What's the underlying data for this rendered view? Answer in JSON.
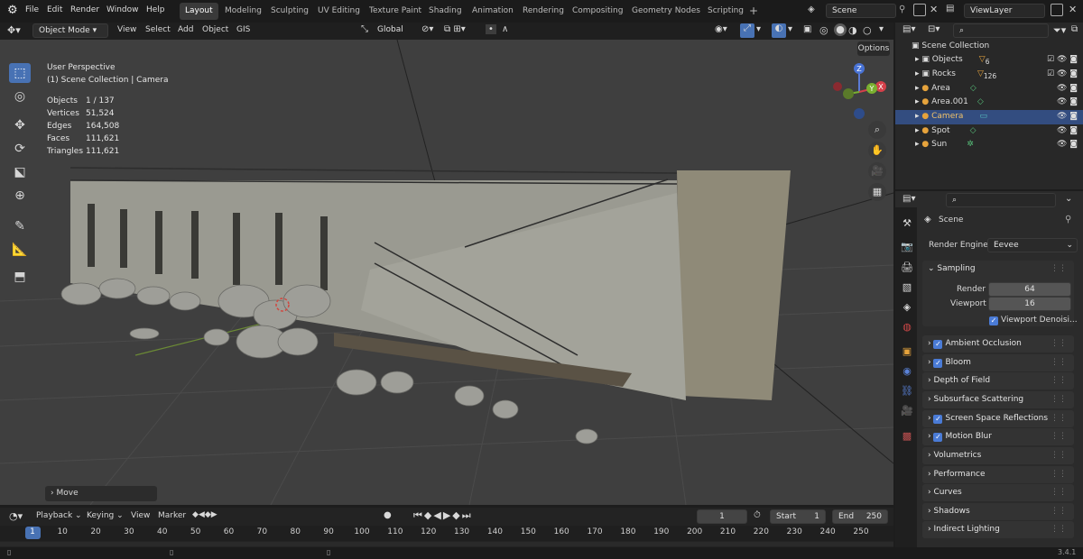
{
  "topbar": {
    "menus": [
      "File",
      "Edit",
      "Render",
      "Window",
      "Help"
    ],
    "workspaces": [
      "Layout",
      "Modeling",
      "Sculpting",
      "UV Editing",
      "Texture Paint",
      "Shading",
      "Animation",
      "Rendering",
      "Compositing",
      "Geometry Nodes",
      "Scripting"
    ],
    "active_workspace": "Layout",
    "add_tab": "+",
    "scene": "Scene",
    "view_layer": "ViewLayer"
  },
  "viewport_header": {
    "mode": "Object Mode",
    "menus": [
      "View",
      "Select",
      "Add",
      "Object",
      "GIS"
    ],
    "orientation": "Global",
    "options": "Options"
  },
  "overlay": {
    "view_name": "User Perspective",
    "collection": "(1) Scene Collection | Camera",
    "stats": [
      {
        "label": "Objects",
        "value": "1 / 137"
      },
      {
        "label": "Vertices",
        "value": "51,524"
      },
      {
        "label": "Edges",
        "value": "164,508"
      },
      {
        "label": "Faces",
        "value": "111,621"
      },
      {
        "label": "Triangles",
        "value": "111,621"
      }
    ]
  },
  "last_operator": "Move",
  "gizmo": {
    "x": "X",
    "y": "Y",
    "z": "Z"
  },
  "outliner": {
    "root": "Scene Collection",
    "items": [
      {
        "name": "Objects",
        "badge": "6"
      },
      {
        "name": "Rocks",
        "badge": "126"
      },
      {
        "name": "Area",
        "badge": ""
      },
      {
        "name": "Area.001",
        "badge": ""
      },
      {
        "name": "Camera",
        "badge": ""
      },
      {
        "name": "Spot",
        "badge": ""
      },
      {
        "name": "Sun",
        "badge": ""
      }
    ],
    "selected": "Camera"
  },
  "properties": {
    "scene_name": "Scene",
    "render_engine_label": "Render Engine",
    "render_engine": "Eevee",
    "sampling": {
      "title": "Sampling",
      "render_label": "Render",
      "render_value": "64",
      "viewport_label": "Viewport",
      "viewport_value": "16",
      "denoise_label": "Viewport Denoisi..."
    },
    "panels": [
      {
        "label": "Ambient Occlusion",
        "checkbox": true
      },
      {
        "label": "Bloom",
        "checkbox": true
      },
      {
        "label": "Depth of Field",
        "checkbox": false
      },
      {
        "label": "Subsurface Scattering",
        "checkbox": false
      },
      {
        "label": "Screen Space Reflections",
        "checkbox": true
      },
      {
        "label": "Motion Blur",
        "checkbox": true
      },
      {
        "label": "Volumetrics",
        "checkbox": false
      },
      {
        "label": "Performance",
        "checkbox": false
      },
      {
        "label": "Curves",
        "checkbox": false
      },
      {
        "label": "Shadows",
        "checkbox": false
      },
      {
        "label": "Indirect Lighting",
        "checkbox": false
      }
    ]
  },
  "timeline": {
    "menus": [
      "Playback",
      "Keying",
      "View",
      "Marker"
    ],
    "current_frame": "1",
    "start_label": "Start",
    "start": "1",
    "end_label": "End",
    "end": "250",
    "ticks": [
      "1",
      "10",
      "20",
      "30",
      "40",
      "50",
      "60",
      "70",
      "80",
      "90",
      "100",
      "110",
      "120",
      "130",
      "140",
      "150",
      "160",
      "170",
      "180",
      "190",
      "200",
      "210",
      "220",
      "230",
      "240",
      "250"
    ]
  },
  "status": {
    "version": "3.4.1"
  },
  "colors": {
    "accent": "#4872b4",
    "selected_row": "#334d80",
    "outline_orange": "#e6a33c"
  }
}
